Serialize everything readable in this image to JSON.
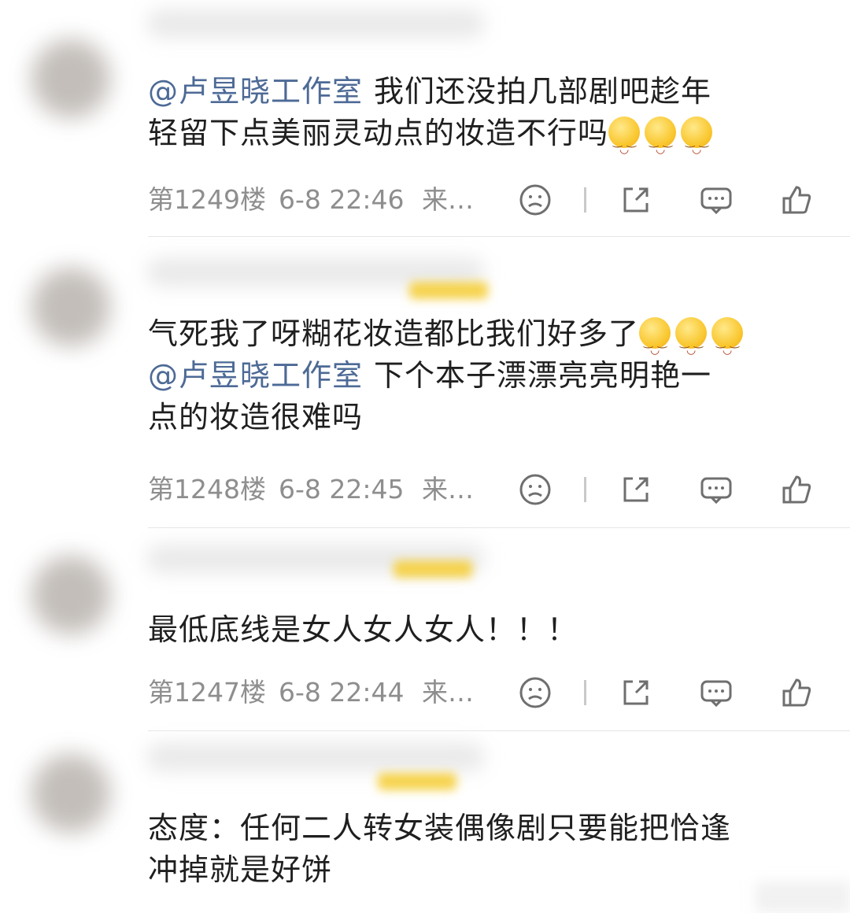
{
  "comments": [
    {
      "mention": "@卢昱晓工作室",
      "text_line1": "我们还没拍几部剧吧趁年",
      "text_line2": "轻留下点美丽灵动点的妆造不行吗",
      "floor": "第1249楼",
      "time": "6-8 22:46",
      "source": "来…"
    },
    {
      "text_line1": "气死我了呀糊花妆造都比我们好多了",
      "mention": "@卢昱晓工作室",
      "text_line2": "下个本子漂漂亮亮明艳一",
      "text_line3": "点的妆造很难吗",
      "floor": "第1248楼",
      "time": "6-8 22:45",
      "source": "来…"
    },
    {
      "text_line1": "最低底线是女人女人女人！！！",
      "floor": "第1247楼",
      "time": "6-8 22:44",
      "source": "来…"
    },
    {
      "text_line1": "态度：任何二人转女装偶像剧只要能把恰逢",
      "text_line2": "冲掉就是好饼"
    }
  ],
  "icons": {
    "dislike": "sad-face-icon",
    "share": "share-icon",
    "reply": "comment-icon",
    "like": "thumbs-up-icon"
  },
  "colors": {
    "mention": "#4d6a96",
    "meta": "#8e8e8e",
    "badge": "#f6cf3a"
  }
}
